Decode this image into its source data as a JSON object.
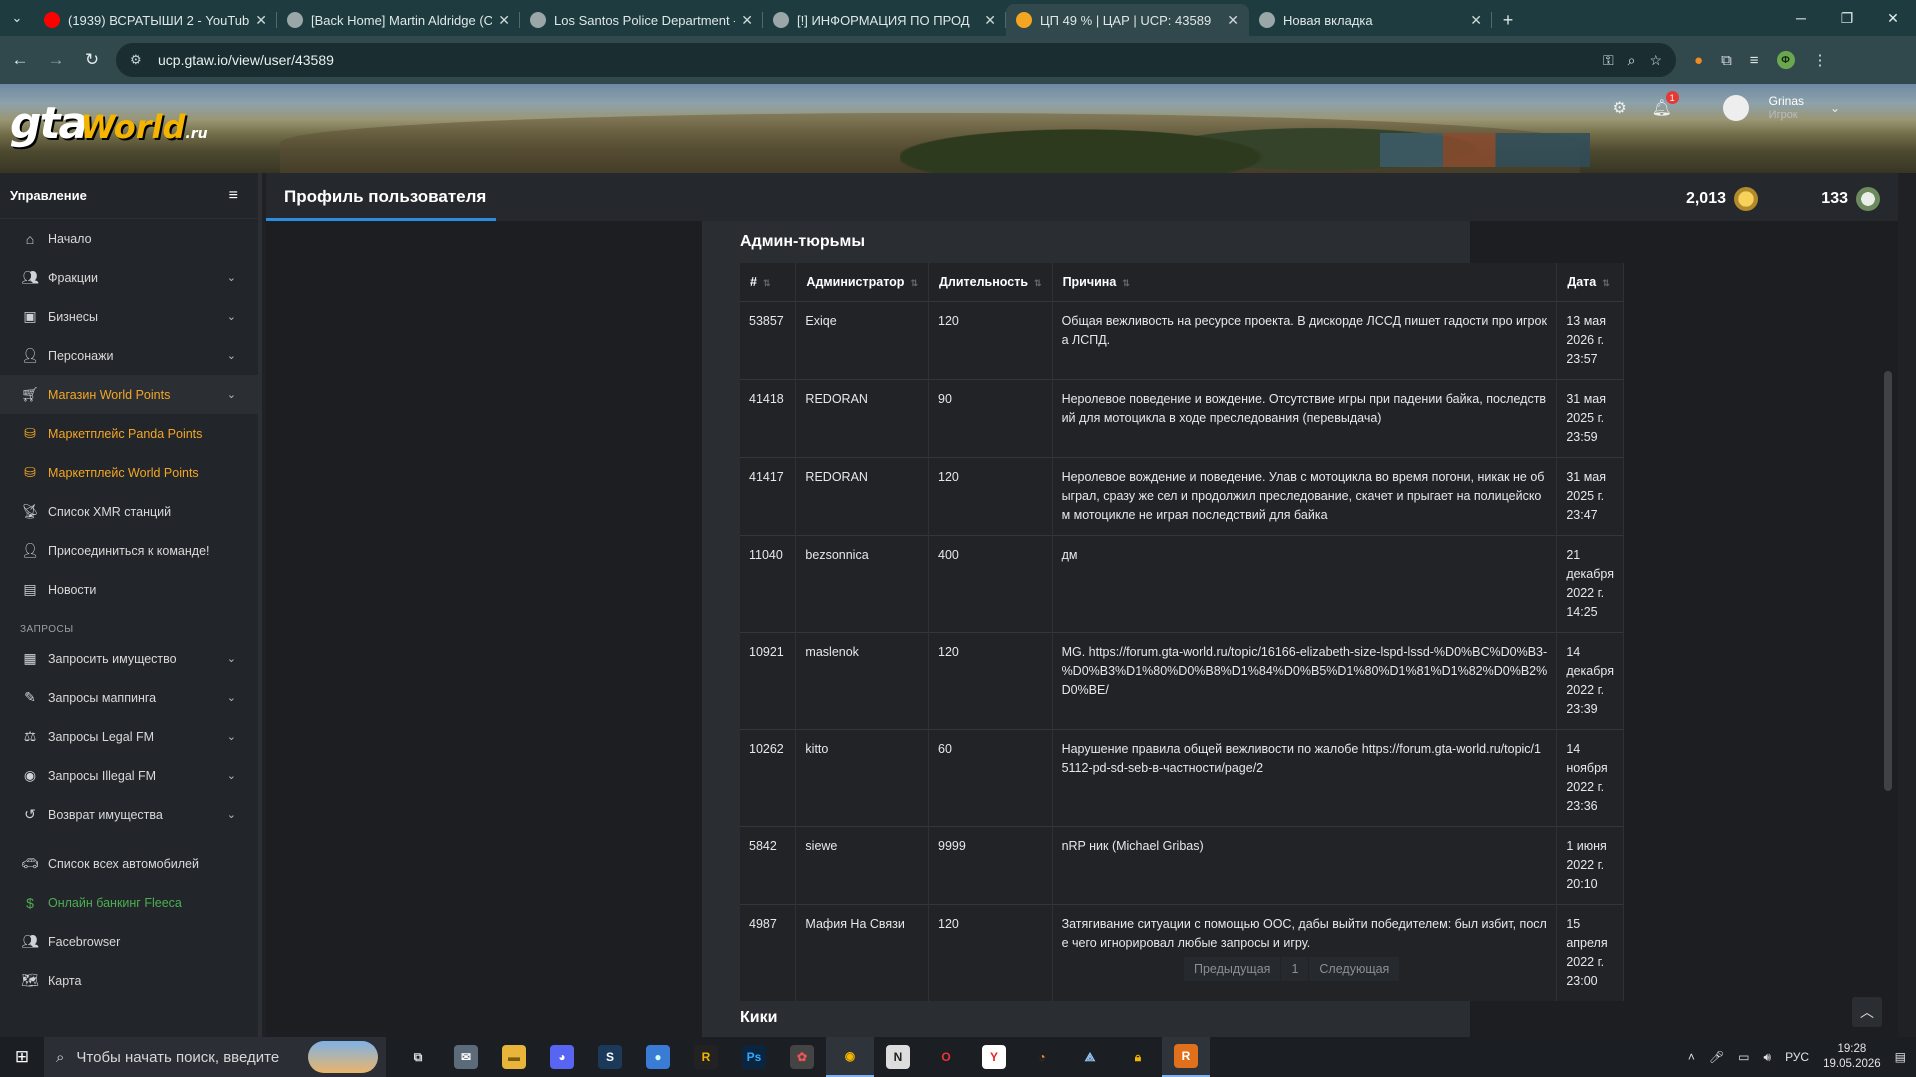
{
  "browser": {
    "tabs": [
      {
        "title": "(1939) ВСРАТЫШИ 2 - YouTube",
        "favicon_color": "#ff0000",
        "active": false
      },
      {
        "title": "[Back Home] Martin Aldridge (С",
        "favicon_color": "#9aa6a8",
        "active": false
      },
      {
        "title": "Los Santos Police Department -",
        "favicon_color": "#9aa6a8",
        "active": false
      },
      {
        "title": "[!] ИНФОРМАЦИЯ ПО ПРОД",
        "favicon_color": "#9aa6a8",
        "active": false
      },
      {
        "title": "ЦП 49 % | ЦАР | UCP: 43589",
        "favicon_color": "#f4a623",
        "active": true
      },
      {
        "title": "Новая вкладка",
        "favicon_color": "#9aa6a8",
        "active": false
      }
    ],
    "url": "ucp.gtaw.io/view/user/43589"
  },
  "header": {
    "logo_gta": "gta",
    "logo_world": "World",
    "logo_ru": ".ru",
    "notification_count": "1",
    "user_name": "Grinas",
    "user_role": "Игрок"
  },
  "sidebar": {
    "title": "Управление",
    "items": [
      {
        "label": "Начало",
        "icon": "home-icon",
        "chevron": false,
        "style": ""
      },
      {
        "label": "Фракции",
        "icon": "users-icon",
        "chevron": true,
        "style": ""
      },
      {
        "label": "Бизнесы",
        "icon": "briefcase-icon",
        "chevron": true,
        "style": ""
      },
      {
        "label": "Персонажи",
        "icon": "user-icon",
        "chevron": true,
        "style": ""
      },
      {
        "label": "Магазин World Points",
        "icon": "cart-icon",
        "chevron": true,
        "style": "active"
      },
      {
        "label": "Маркетплейс Panda Points",
        "icon": "coins-icon",
        "chevron": false,
        "style": "gold"
      },
      {
        "label": "Маркетплейс World Points",
        "icon": "coins-icon",
        "chevron": false,
        "style": "gold"
      },
      {
        "label": "Список XMR станций",
        "icon": "antenna-icon",
        "chevron": false,
        "style": ""
      },
      {
        "label": "Присоединиться к команде!",
        "icon": "user-tie-icon",
        "chevron": false,
        "style": ""
      },
      {
        "label": "Новости",
        "icon": "newspaper-icon",
        "chevron": false,
        "style": ""
      }
    ],
    "requests_section": "ЗАПРОСЫ",
    "request_items": [
      {
        "label": "Запросить имущество",
        "icon": "building-icon",
        "chevron": true,
        "style": ""
      },
      {
        "label": "Запросы маппинга",
        "icon": "brush-icon",
        "chevron": true,
        "style": ""
      },
      {
        "label": "Запросы Legal FM",
        "icon": "scale-icon",
        "chevron": true,
        "style": ""
      },
      {
        "label": "Запросы Illegal FM",
        "icon": "mask-icon",
        "chevron": true,
        "style": ""
      },
      {
        "label": "Возврат имущества",
        "icon": "undo-icon",
        "chevron": true,
        "style": ""
      }
    ],
    "bottom_items": [
      {
        "label": "Список всех автомобилей",
        "icon": "car-icon",
        "chevron": false,
        "style": ""
      },
      {
        "label": "Онлайн банкинг Fleeca",
        "icon": "money-icon",
        "chevron": false,
        "style": "green"
      },
      {
        "label": "Facebrowser",
        "icon": "users-icon",
        "chevron": false,
        "style": ""
      },
      {
        "label": "Карта",
        "icon": "map-icon",
        "chevron": false,
        "style": ""
      }
    ]
  },
  "titlebar": {
    "title": "Профиль пользователя",
    "points_1": "2,013",
    "points_2": "133"
  },
  "jails": {
    "title": "Админ-тюрьмы",
    "columns": [
      "#",
      "Администратор",
      "Длительность",
      "Причина",
      "Дата"
    ],
    "rows": [
      {
        "id": "53857",
        "admin": "Exiqe",
        "duration": "120",
        "reason": "Общая вежливость на ресурсе проекта. В дискорде ЛССД пишет гадости про игрока ЛСПД.",
        "date": "13 мая 2026 г. 23:57"
      },
      {
        "id": "41418",
        "admin": "REDORAN",
        "duration": "90",
        "reason": "Неролевое поведение и вождение. Отсутствие игры при падении байка, последствий для мотоцикла в ходе преследования (перевыдача)",
        "date": "31 мая 2025 г. 23:59"
      },
      {
        "id": "41417",
        "admin": "REDORAN",
        "duration": "120",
        "reason": "Неролевое вождение и поведение. Улав с мотоцикла во время погони, никак не обыграл, сразу же сел и продолжил преследование, скачет и прыгает на полицейском мотоцикле не играя последствий для байка",
        "date": "31 мая 2025 г. 23:47"
      },
      {
        "id": "11040",
        "admin": "bezsonnica",
        "duration": "400",
        "reason": "дм",
        "date": "21 декабря 2022 г. 14:25"
      },
      {
        "id": "10921",
        "admin": "maslenok",
        "duration": "120",
        "reason": "MG. https://forum.gta-world.ru/topic/16166-elizabeth-size-lspd-lssd-%D0%BC%D0%B3-%D0%B3%D1%80%D0%B8%D1%84%D0%B5%D1%80%D1%81%D1%82%D0%B2%D0%BE/",
        "date": "14 декабря 2022 г. 23:39"
      },
      {
        "id": "10262",
        "admin": "kitto",
        "duration": "60",
        "reason": "Нарушение правила общей вежливости по жалобе https://forum.gta-world.ru/topic/15112-pd-sd-seb-в-частности/page/2",
        "date": "14 ноября 2022 г. 23:36"
      },
      {
        "id": "5842",
        "admin": "siewe",
        "duration": "9999",
        "reason": "nRP ник (Michael Gribas)",
        "date": "1 июня 2022 г. 20:10"
      },
      {
        "id": "4987",
        "admin": "Мафия На Связи",
        "duration": "120",
        "reason": "Затягивание ситуации с помощью ООС, дабы выйти победителем: был избит, после чего игнорировал любые запросы и игру.",
        "date": "15 апреля 2022 г. 23:00"
      }
    ],
    "pager_prev": "Предыдущая",
    "pager_page": "1",
    "pager_next": "Следующая"
  },
  "kicks": {
    "title": "Кики"
  },
  "taskbar": {
    "search_placeholder": "Чтобы начать поиск, введите",
    "lang": "РУС",
    "time": "19:28",
    "date": "19.05.2026"
  }
}
